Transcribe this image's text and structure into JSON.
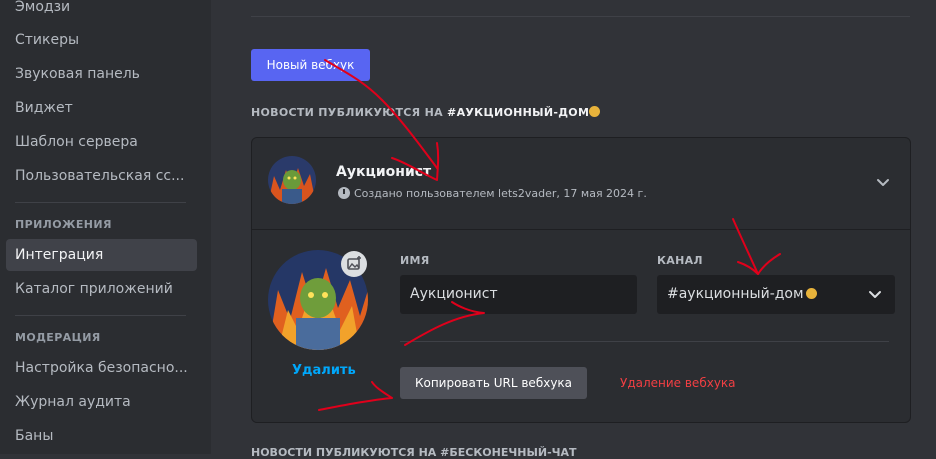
{
  "sidebar": {
    "items_top": [
      {
        "label": "Эмодзи"
      },
      {
        "label": "Стикеры"
      },
      {
        "label": "Звуковая панель"
      },
      {
        "label": "Виджет"
      },
      {
        "label": "Шаблон сервера"
      },
      {
        "label": "Пользовательская сс..."
      }
    ],
    "section_apps": "ПРИЛОЖЕНИЯ",
    "items_apps": [
      {
        "label": "Интеграция"
      },
      {
        "label": "Каталог приложений"
      }
    ],
    "section_moderation": "МОДЕРАЦИЯ",
    "items_moderation": [
      {
        "label": "Настройка безопасно..."
      },
      {
        "label": "Журнал аудита"
      },
      {
        "label": "Баны"
      }
    ]
  },
  "main": {
    "new_webhook_label": "Новый вебхук",
    "section_prefix": "НОВОСТИ ПУБЛИКУЮТСЯ НА",
    "section_channel": "#АУКЦИОННЫЙ-ДОМ",
    "webhook": {
      "name": "Аукционист",
      "meta": "Создано пользователем lets2vader, 17 мая 2024 г.",
      "name_label": "ИМЯ",
      "name_value": "Аукционист",
      "channel_label": "КАНАЛ",
      "channel_value": "#аукционный-дом",
      "delete_avatar_label": "Удалить",
      "copy_url_label": "Копировать URL вебхука",
      "delete_webhook_label": "Удаление вебхука"
    },
    "next_section_partial": "НОВОСТИ ПУБЛИКУЮТСЯ НА #БЕСКОНЕЧНЫЙ-ЧАТ"
  },
  "colors": {
    "accent": "#5865f2",
    "danger": "#f23f43",
    "link": "#00a8fc",
    "annotation": "#e0001b"
  },
  "icons": [
    "clock-icon",
    "chevron-down-icon",
    "image-edit-icon",
    "money-bag-emoji-icon"
  ]
}
